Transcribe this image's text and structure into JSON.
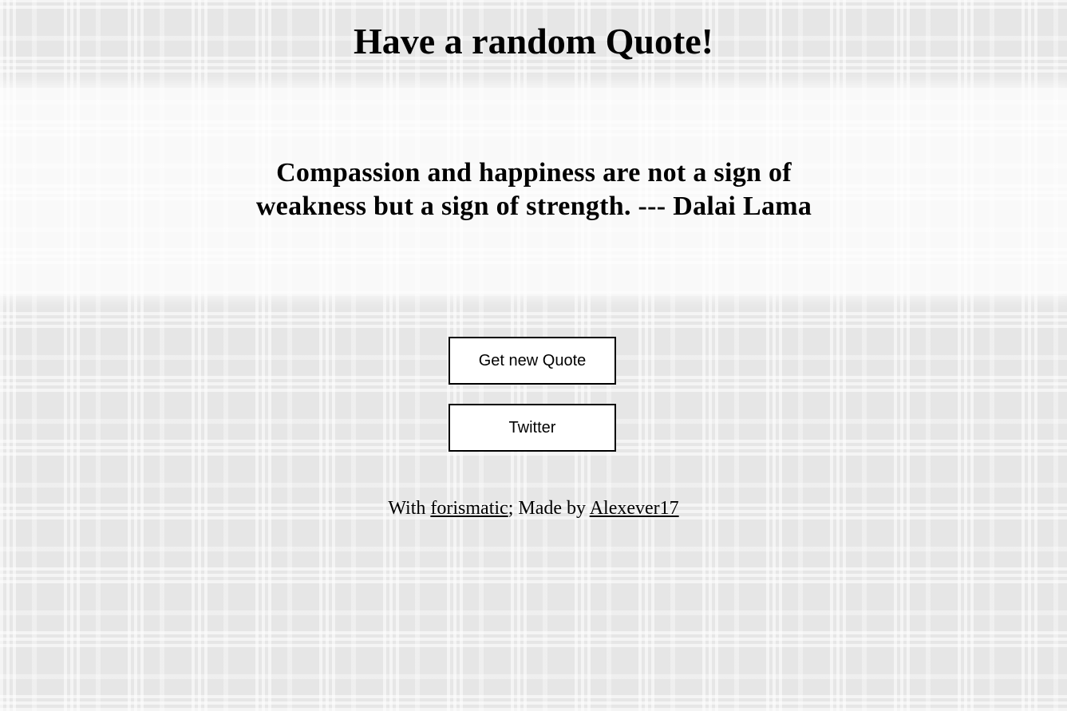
{
  "page": {
    "title": "Have a random Quote!"
  },
  "quote": {
    "text": "Compassion and happiness are not a sign of weakness but a sign of strength. --- Dalai Lama"
  },
  "buttons": {
    "new_quote_label": "Get new Quote",
    "twitter_label": "Twitter"
  },
  "footer": {
    "prefix": "With ",
    "source_link": "forismatic",
    "middle": "; Made by ",
    "author_link": "Alexever17"
  },
  "colors": {
    "background": "#e6e6e6",
    "text": "#000000",
    "button_bg": "#ffffff",
    "button_border": "#000000"
  }
}
